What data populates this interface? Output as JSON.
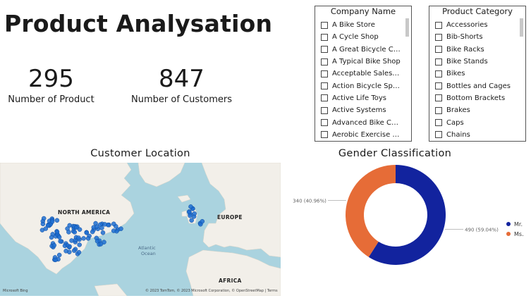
{
  "header": {
    "title": "Product Analysation"
  },
  "kpis": [
    {
      "value": "295",
      "label": "Number of Product"
    },
    {
      "value": "847",
      "label": "Number of Customers"
    }
  ],
  "slicers": {
    "company": {
      "title": "Company Name",
      "items": [
        "A Bike Store",
        "A Cycle Shop",
        "A Great Bicycle Company",
        "A Typical Bike Shop",
        "Acceptable Sales & Servi...",
        "Action Bicycle Specialists",
        "Active Life Toys",
        "Active Systems",
        "Advanced Bike Compon...",
        "Aerobic Exercise Company"
      ]
    },
    "category": {
      "title": "Product Category",
      "items": [
        "Accessories",
        "Bib-Shorts",
        "Bike Racks",
        "Bike Stands",
        "Bikes",
        "Bottles and Cages",
        "Bottom Brackets",
        "Brakes",
        "Caps",
        "Chains"
      ]
    }
  },
  "map": {
    "title": "Customer Location",
    "labels": {
      "north_america": "NORTH AMERICA",
      "europe": "EUROPE",
      "africa": "AFRICA",
      "ocean_1": "Atlantic",
      "ocean_2": "Ocean"
    },
    "credit_logo": "Microsoft Bing",
    "credit_text": "© 2023 TomTom, © 2023 Microsoft Corporation, © OpenStreetMap | Terms",
    "water_color": "#aad3df",
    "land_color": "#f2efe9",
    "dot_color": "#1f6fd1"
  },
  "chart_data": {
    "type": "pie",
    "title": "Gender Classification",
    "donut": true,
    "categories": [
      "Mr.",
      "Ms."
    ],
    "values": [
      490,
      340
    ],
    "data_labels": [
      "490 (59.04%)",
      "340 (40.96%)"
    ],
    "colors": [
      "#12239e",
      "#e66c37"
    ],
    "legend_position": "right"
  }
}
